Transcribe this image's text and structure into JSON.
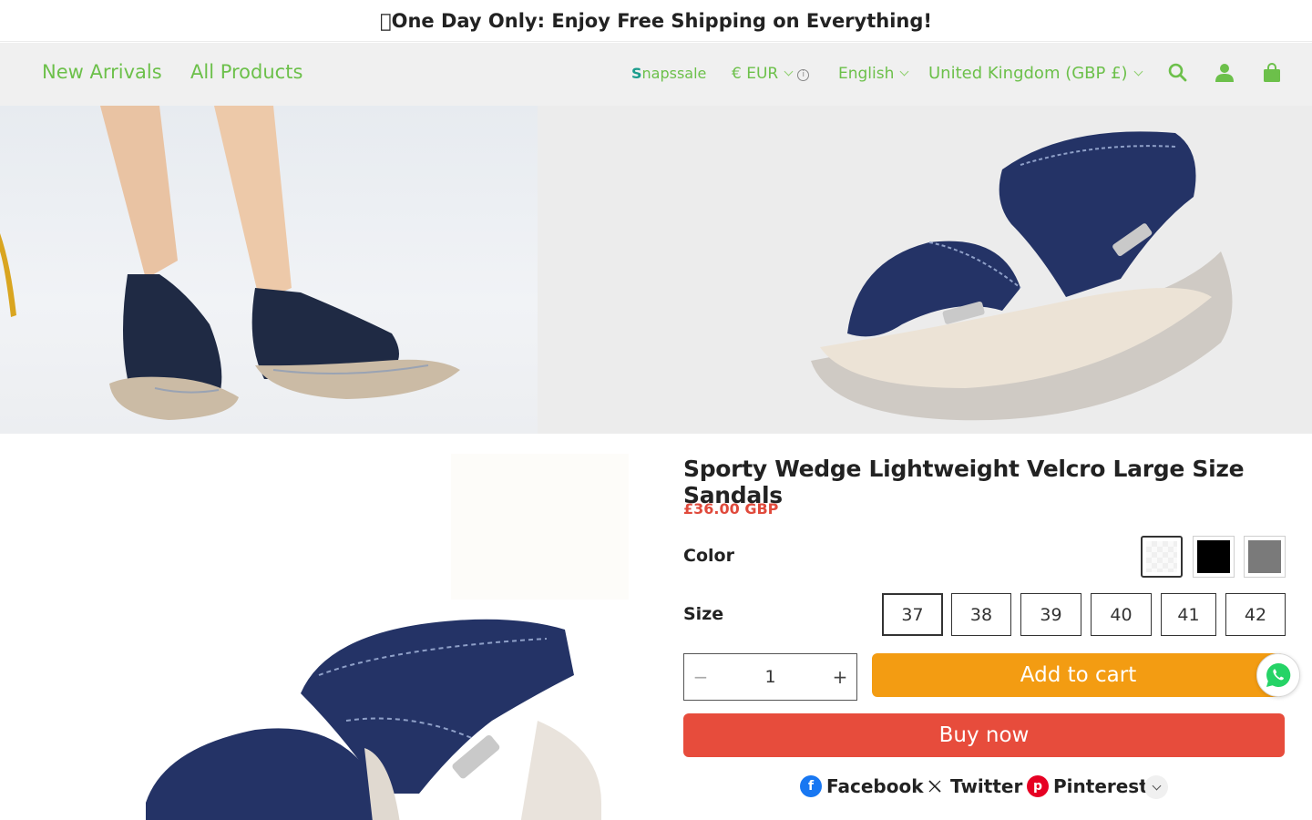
{
  "announcement": {
    "text": "\u0000One Day Only: Enjoy Free Shipping on Everything!"
  },
  "nav": {
    "links": [
      "New Arrivals",
      "All Products"
    ],
    "snapssale": "Snapssale",
    "currency": "€ EUR",
    "info_glyph": "i",
    "language": "English",
    "region": "United Kingdom (GBP £)"
  },
  "product": {
    "title": "Sporty Wedge Lightweight Velcro Large Size Sandals",
    "price": "£36.00 GBP",
    "color_label": "Color",
    "colors": [
      {
        "name": "navy",
        "hex": "#e9e9e9",
        "selected": true
      },
      {
        "name": "black",
        "hex": "#000000",
        "selected": false
      },
      {
        "name": "grey",
        "hex": "#7a7a7a",
        "selected": false
      }
    ],
    "size_label": "Size",
    "sizes": [
      "37",
      "38",
      "39",
      "40",
      "41",
      "42"
    ],
    "selected_size": "37",
    "quantity": "1",
    "minus": "−",
    "plus": "+",
    "add_to_cart": "Add to cart",
    "buy_now": "Buy now"
  },
  "share": {
    "facebook": "Facebook",
    "twitter": "Twitter",
    "pinterest": "Pinterest"
  },
  "colors": {
    "accent_green": "#6cc04a",
    "add_to_cart": "#f39c12",
    "buy_now": "#e74c3c",
    "price": "#e04a3c",
    "sandal_navy": "#2c3e6b"
  }
}
